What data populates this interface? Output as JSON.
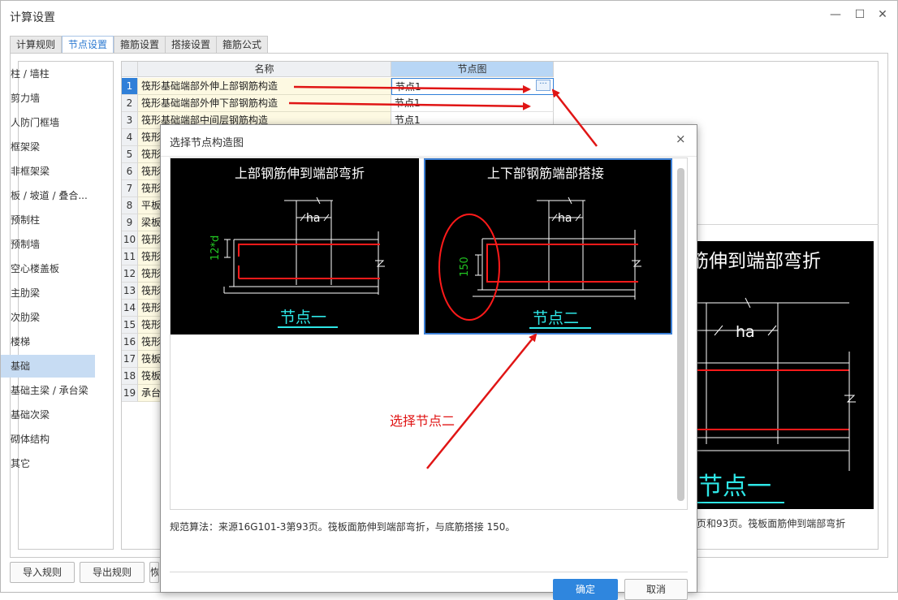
{
  "window": {
    "title": "计算设置"
  },
  "tabs": [
    {
      "label": "计算规则"
    },
    {
      "label": "节点设置"
    },
    {
      "label": "箍筋设置"
    },
    {
      "label": "搭接设置"
    },
    {
      "label": "箍筋公式"
    }
  ],
  "sidebar": {
    "items": [
      {
        "label": "柱 / 墙柱"
      },
      {
        "label": "剪力墙"
      },
      {
        "label": "人防门框墙"
      },
      {
        "label": "框架梁"
      },
      {
        "label": "非框架梁"
      },
      {
        "label": "板 / 坡道 / 叠合..."
      },
      {
        "label": "预制柱"
      },
      {
        "label": "预制墙"
      },
      {
        "label": "空心楼盖板"
      },
      {
        "label": "主肋梁"
      },
      {
        "label": "次肋梁"
      },
      {
        "label": "楼梯"
      },
      {
        "label": "基础"
      },
      {
        "label": "基础主梁 / 承台梁"
      },
      {
        "label": "基础次梁"
      },
      {
        "label": "砌体结构"
      },
      {
        "label": "其它"
      }
    ]
  },
  "grid": {
    "headers": {
      "name": "名称",
      "node": "节点图"
    },
    "rows": [
      {
        "num": "1",
        "name": "筏形基础端部外伸上部钢筋构造",
        "node": "节点1"
      },
      {
        "num": "2",
        "name": "筏形基础端部外伸下部钢筋构造",
        "node": "节点1"
      },
      {
        "num": "3",
        "name": "筏形基础端部中间层钢筋构造",
        "node": "节点1"
      },
      {
        "num": "4",
        "name": "筏形",
        "node": ""
      },
      {
        "num": "5",
        "name": "筏形",
        "node": ""
      },
      {
        "num": "6",
        "name": "筏形",
        "node": ""
      },
      {
        "num": "7",
        "name": "筏形",
        "node": ""
      },
      {
        "num": "8",
        "name": "平板",
        "node": ""
      },
      {
        "num": "9",
        "name": "梁板",
        "node": ""
      },
      {
        "num": "10",
        "name": "筏形",
        "node": ""
      },
      {
        "num": "11",
        "name": "筏形",
        "node": ""
      },
      {
        "num": "12",
        "name": "筏形",
        "node": ""
      },
      {
        "num": "13",
        "name": "筏形",
        "node": ""
      },
      {
        "num": "14",
        "name": "筏形",
        "node": ""
      },
      {
        "num": "15",
        "name": "筏形",
        "node": ""
      },
      {
        "num": "16",
        "name": "筏形",
        "node": ""
      },
      {
        "num": "17",
        "name": "筏板",
        "node": ""
      },
      {
        "num": "18",
        "name": "筏板",
        "node": ""
      },
      {
        "num": "19",
        "name": "承台",
        "node": ""
      }
    ],
    "ellipsis": "···"
  },
  "background_panel": {
    "big_title": "筋伸到端部弯折",
    "ha": "ha",
    "node_label": "节点一",
    "note": "页和93页。筏板面筋伸到端部弯折"
  },
  "buttons": {
    "import": "导入规则",
    "export": "导出规则",
    "third": "恢"
  },
  "dialog": {
    "title": "选择节点构造图",
    "close": "×",
    "options": [
      {
        "title": "上部钢筋伸到端部弯折",
        "dim": "12*d",
        "ha": "ha",
        "label": "节点一"
      },
      {
        "title": "上下部钢筋端部搭接",
        "dim": "150",
        "ha": "ha",
        "label": "节点二"
      }
    ],
    "note": "规范算法：来源16G101-3第93页。筏板面筋伸到端部弯折，与底筋搭接 150。",
    "ok": "确定",
    "cancel": "取消"
  },
  "annotation": {
    "text": "选择节点二"
  },
  "colors": {
    "accent": "#2f7fd8",
    "annotation_red": "#e01515",
    "rebar_red": "#ff1a1a",
    "dim_green": "#22c422",
    "label_cyan": "#2ee6e6"
  }
}
